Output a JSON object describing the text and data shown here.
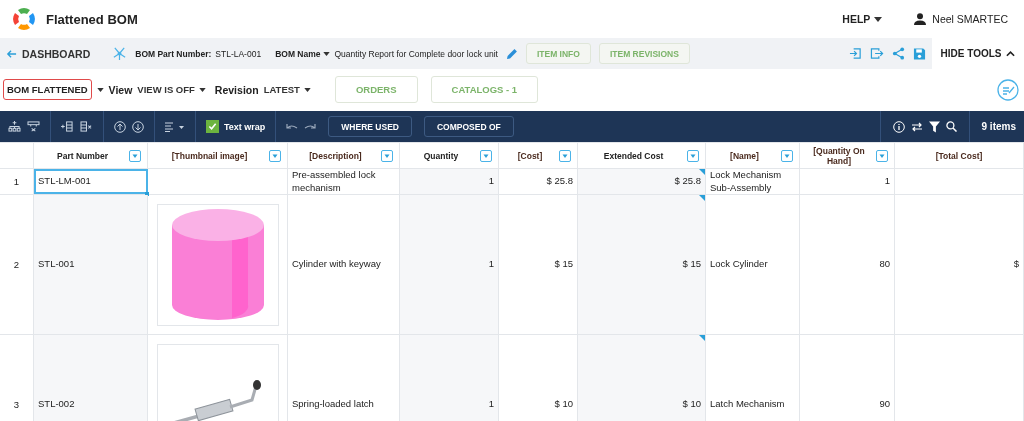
{
  "app": {
    "title": "Flattened BOM"
  },
  "header": {
    "help": "HELP",
    "user": "Neel SMARTEC"
  },
  "bom_bar": {
    "back": "DASHBOARD",
    "part_number_label": "BOM Part Number:",
    "part_number": "STL-LA-001",
    "name_label": "BOM Name",
    "name": "Quantity Report for Complete door lock unit",
    "buttons": [
      "ITEM INFO",
      "ITEM REVISIONS"
    ],
    "hide_tools": "HIDE TOOLS"
  },
  "view_bar": {
    "bom_label": "BOM",
    "bom_value": "FLATTENED",
    "view_label": "View",
    "view_value": "VIEW IS OFF",
    "revision_label": "Revision",
    "revision_value": "LATEST",
    "buttons": [
      "ORDERS",
      "CATALOGS - 1"
    ]
  },
  "grid_toolbar": {
    "text_wrap": {
      "label": "Text wrap",
      "checked": true
    },
    "buttons": [
      "WHERE USED",
      "COMPOSED OF"
    ],
    "count": "9 items"
  },
  "table": {
    "columns": [
      {
        "label": "Part Number",
        "kind": "standard",
        "filter": true
      },
      {
        "label": "[Thumbnail image]",
        "kind": "custom",
        "filter": true
      },
      {
        "label": "[Description]",
        "kind": "custom",
        "filter": true
      },
      {
        "label": "Quantity",
        "kind": "standard",
        "filter": true
      },
      {
        "label": "[Cost]",
        "kind": "custom",
        "filter": true
      },
      {
        "label": "Extended Cost",
        "kind": "standard",
        "filter": true
      },
      {
        "label": "[Name]",
        "kind": "custom",
        "filter": true
      },
      {
        "label": "[Quantity On Hand]",
        "kind": "custom",
        "filter": true
      },
      {
        "label": "[Total Cost]",
        "kind": "custom",
        "filter": false
      }
    ],
    "rows": [
      {
        "number": "1",
        "part": "STL-LM-001",
        "selected": true,
        "kind": "plain",
        "description": "Pre-assembled lock mechanism",
        "quantity": "1",
        "cost": "$ 25.8",
        "extended_cost": "$ 25.8",
        "name": "Lock Mechanism Sub-Assembly",
        "on_hand": "1"
      },
      {
        "number": "2",
        "part": "STL-001",
        "selected": false,
        "kind": "cylinder",
        "description": "Cylinder with keyway",
        "quantity": "1",
        "cost": "$ 15",
        "extended_cost": "$ 15",
        "name": "Lock Cylinder",
        "on_hand": "80",
        "total_cost": "$"
      },
      {
        "number": "3",
        "part": "STL-002",
        "selected": false,
        "kind": "latch",
        "description": "Spring-loaded latch",
        "quantity": "1",
        "cost": "$ 10",
        "extended_cost": "$ 10",
        "name": "Latch Mechanism",
        "on_hand": "90"
      }
    ]
  }
}
